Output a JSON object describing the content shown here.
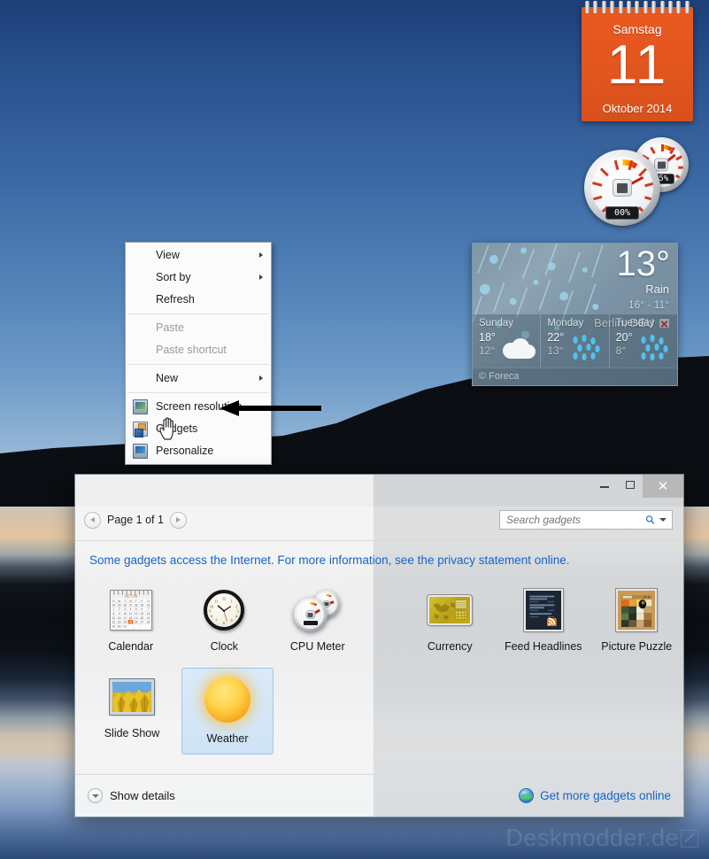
{
  "desktop": {
    "wallpaper_name": "blue-sunset-lake-wallpaper",
    "watermark": {
      "text": "Deskmodder.de",
      "icon": "pencil-icon"
    }
  },
  "calendar_gadget": {
    "weekday": "Samstag",
    "day": "11",
    "month_year": "Oktober 2014",
    "accent_color": "#e4571f"
  },
  "cpu_gadget": {
    "cpu_label": "00%",
    "memory_label": "25%",
    "cpu_icon": "cpu-chip-icon",
    "memory_icon": "memory-chip-icon"
  },
  "weather_gadget": {
    "current_temp": "13°",
    "condition": "Rain",
    "high_low": "16°  -  11°",
    "location": "Berlin, DEU",
    "location_badge_icon": "location-error-icon",
    "provider": "© Foreca",
    "forecast": [
      {
        "day": "Sunday",
        "high": "18°",
        "low": "12°",
        "icon": "cloudy-icon"
      },
      {
        "day": "Monday",
        "high": "22°",
        "low": "13°",
        "icon": "rain-icon"
      },
      {
        "day": "Tuesday",
        "high": "20°",
        "low": "8°",
        "icon": "rain-icon"
      }
    ]
  },
  "context_menu": {
    "items": [
      {
        "label": "View",
        "submenu": true,
        "disabled": false,
        "icon": null
      },
      {
        "label": "Sort by",
        "submenu": true,
        "disabled": false,
        "icon": null
      },
      {
        "label": "Refresh",
        "submenu": false,
        "disabled": false,
        "icon": null
      },
      {
        "label": "Paste",
        "submenu": false,
        "disabled": true,
        "icon": null
      },
      {
        "label": "Paste shortcut",
        "submenu": false,
        "disabled": true,
        "icon": null
      },
      {
        "label": "New",
        "submenu": true,
        "disabled": false,
        "icon": null
      },
      {
        "label": "Screen resolution",
        "submenu": false,
        "disabled": false,
        "icon": "monitor-icon"
      },
      {
        "label": "Gadgets",
        "submenu": false,
        "disabled": false,
        "icon": "gadgets-icon"
      },
      {
        "label": "Personalize",
        "submenu": false,
        "disabled": false,
        "icon": "personalize-icon"
      }
    ]
  },
  "annotation": {
    "arrow": "left-pointing-arrow",
    "target": "Gadgets"
  },
  "cursor": {
    "type": "hand-pointer"
  },
  "gallery": {
    "window_controls": {
      "minimize": "–",
      "maximize": "□",
      "close": "✕"
    },
    "pager": {
      "label": "Page 1 of 1",
      "prev": "◀",
      "next": "▶"
    },
    "search": {
      "placeholder": "Search gadgets",
      "value": ""
    },
    "notice": "Some gadgets access the Internet.  For more information, see the privacy statement online.",
    "gadgets": [
      {
        "name": "Calendar",
        "icon": "calendar-thumb",
        "selected": false
      },
      {
        "name": "Clock",
        "icon": "clock-thumb",
        "selected": false
      },
      {
        "name": "CPU Meter",
        "icon": "cpu-meter-thumb",
        "selected": false
      },
      {
        "name": "Currency",
        "icon": "currency-thumb",
        "selected": false
      },
      {
        "name": "Feed Headlines",
        "icon": "feed-headlines-thumb",
        "selected": false
      },
      {
        "name": "Picture Puzzle",
        "icon": "picture-puzzle-thumb",
        "selected": false
      },
      {
        "name": "Slide Show",
        "icon": "slide-show-thumb",
        "selected": false
      },
      {
        "name": "Weather",
        "icon": "weather-sun-thumb",
        "selected": true
      }
    ],
    "calendar_thumb": {
      "header": "OCT 06",
      "selected_day": "25"
    },
    "status": {
      "show_details": "Show details",
      "get_more": "Get more gadgets online",
      "link_color": "#1664c4"
    }
  }
}
